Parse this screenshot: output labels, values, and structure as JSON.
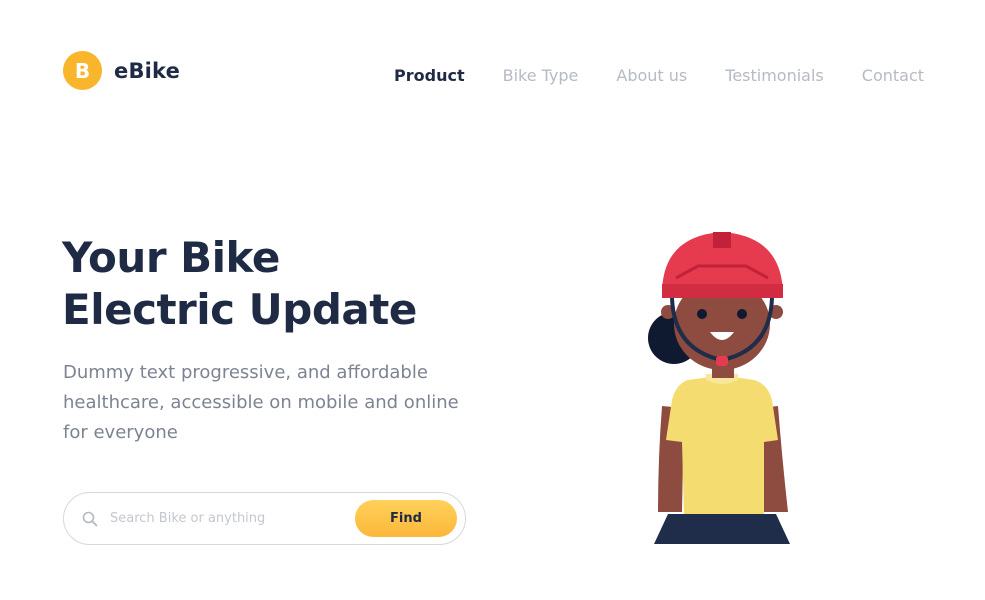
{
  "brand": {
    "badge_letter": "B",
    "name": "eBike",
    "accent_color": "#f9b52b"
  },
  "nav": {
    "items": [
      {
        "label": "Product",
        "active": true
      },
      {
        "label": "Bike Type",
        "active": false
      },
      {
        "label": "About us",
        "active": false
      },
      {
        "label": "Testimonials",
        "active": false
      },
      {
        "label": "Contact",
        "active": false
      }
    ]
  },
  "hero": {
    "title_line1": "Your Bike",
    "title_line2": "Electric Update",
    "description": "Dummy text progressive, and affordable healthcare, accessible on mobile and online for everyone"
  },
  "search": {
    "icon": "search-icon",
    "placeholder": "Search Bike or anything",
    "value": "",
    "button_label": "Find"
  },
  "illustration": {
    "subject": "person-with-bike-helmet",
    "helmet_color": "#e63a4f",
    "shirt_color": "#f5dc70",
    "skin_color": "#8e4b3f",
    "hair_color": "#0f1930"
  }
}
